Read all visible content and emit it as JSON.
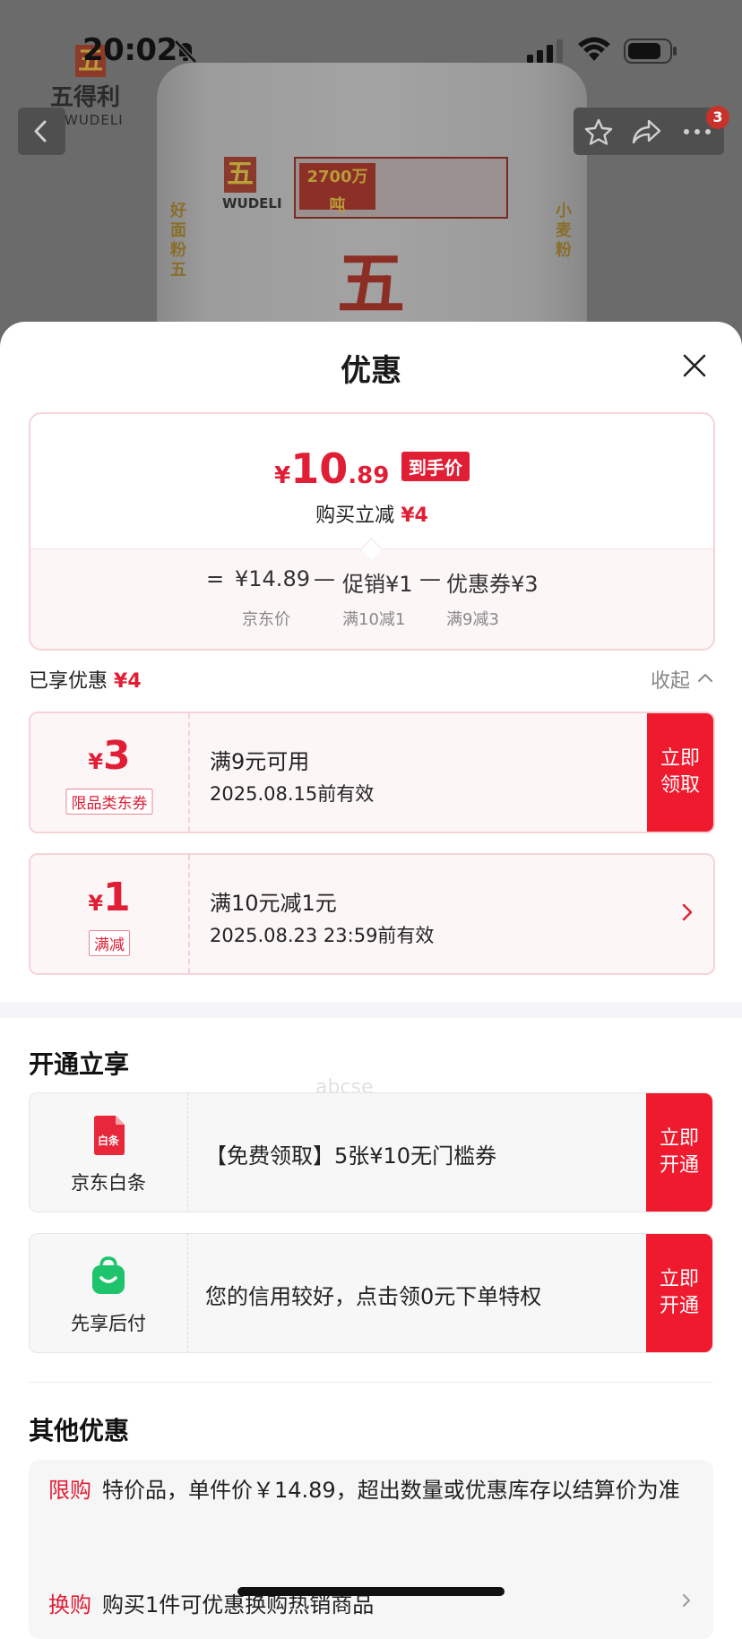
{
  "status_bar": {
    "time": "20:02"
  },
  "nav": {
    "badge_count": "3"
  },
  "product_bg": {
    "brand_cn": "五得利",
    "brand_en": "WUDELI",
    "bag_brand_en": "WUDELI",
    "bag_box_text": "2700万吨",
    "bag_big_char": "五",
    "bag_side_left": "好面粉五",
    "bag_side_right": "小麦粉"
  },
  "sheet": {
    "title": "优惠"
  },
  "summary": {
    "currency": "¥",
    "price_int": "10",
    "price_dec": ".89",
    "price_tag": "到手价",
    "instant_label": "购买立减",
    "instant_amount": "¥4",
    "eq": "=",
    "jd_price": "¥14.89",
    "minus1": "—",
    "promo": "促销¥1",
    "minus2": "—",
    "coupon": "优惠券¥3",
    "jd_price_label": "京东价",
    "promo_label": "满10减1",
    "coupon_label": "满9减3"
  },
  "enjoyed": {
    "label": "已享优惠",
    "amount": "¥4",
    "collapse": "收起"
  },
  "coupons": [
    {
      "currency": "¥",
      "value": "3",
      "tag": "限品类东券",
      "line1": "满9元可用",
      "line2": "2025.08.15前有效",
      "action": "立即\n领取"
    },
    {
      "currency": "¥",
      "value": "1",
      "tag": "满减",
      "line1": "满10元减1元",
      "line2": "2025.08.23 23:59前有效"
    }
  ],
  "open_section": {
    "title": "开通立享",
    "items": [
      {
        "label": "京东白条",
        "icon_text": "白条",
        "desc": "【免费领取】5张¥10无门槛券",
        "action": "立即\n开通"
      },
      {
        "label": "先享后付",
        "desc": "您的信用较好，点击领0元下单特权",
        "action": "立即\n开通"
      }
    ]
  },
  "other_section": {
    "title": "其他优惠",
    "rows": [
      {
        "kw": "限购",
        "text": "特价品，单件价￥14.89，超出数量或优惠库存以结算价为准"
      },
      {
        "kw": "换购",
        "text": "购买1件可优惠换购热销商品"
      }
    ]
  },
  "watermark": "abcse",
  "colors": {
    "accent": "#e01e35",
    "action_bg": "#f01a2f",
    "coupon_bg": "#fdf6f7",
    "coupon_border": "#f6d4d7"
  }
}
